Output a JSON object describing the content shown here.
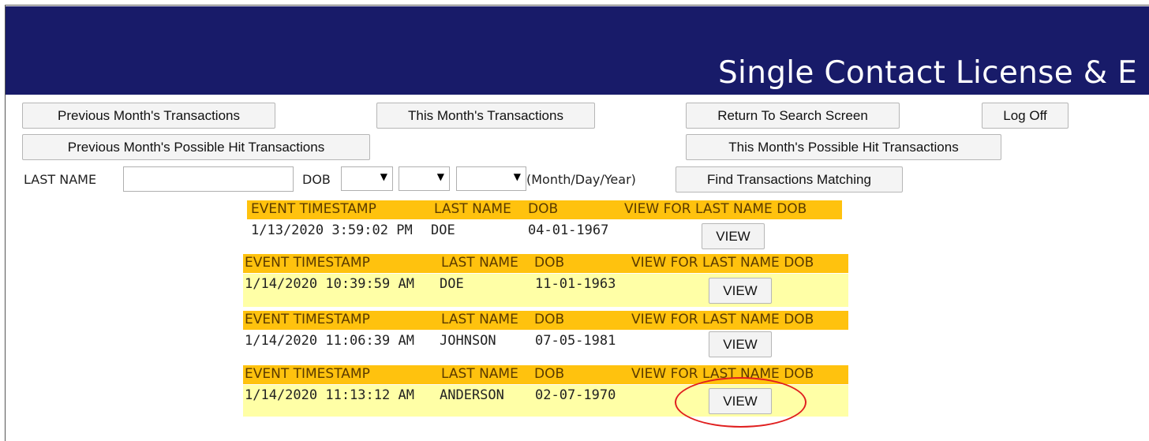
{
  "banner": {
    "title": "Single Contact License & E"
  },
  "nav": {
    "prev_month": "Previous Month's Transactions",
    "this_month": "This Month's Transactions",
    "return_search": "Return To Search Screen",
    "log_off": "Log  Off",
    "prev_month_hits": "Previous Month's Possible Hit Transactions",
    "this_month_hits": "This Month's Possible Hit Transactions"
  },
  "search": {
    "last_name_label": "LAST NAME",
    "last_name_value": "",
    "dob_label": "DOB",
    "month_value": "",
    "day_value": "",
    "year_value": "",
    "format_hint": "(Month/Day/Year)",
    "find_button": "Find Transactions Matching"
  },
  "results_headers": {
    "timestamp": "EVENT TIMESTAMP",
    "last_name": "LAST NAME",
    "dob": "DOB",
    "view": "VIEW FOR LAST NAME DOB"
  },
  "results": [
    {
      "timestamp": "1/13/2020 3:59:02 PM",
      "last_name": "DOE",
      "dob": "04-01-1967",
      "view_label": "VIEW"
    },
    {
      "timestamp": "1/14/2020 10:39:59 AM",
      "last_name": "DOE",
      "dob": "11-01-1963",
      "view_label": "VIEW"
    },
    {
      "timestamp": "1/14/2020 11:06:39 AM",
      "last_name": "JOHNSON",
      "dob": "07-05-1981",
      "view_label": "VIEW"
    },
    {
      "timestamp": "1/14/2020 11:13:12 AM",
      "last_name": "ANDERSON",
      "dob": "02-07-1970",
      "view_label": "VIEW"
    }
  ],
  "colors": {
    "banner": "#181b69",
    "header_row": "#ffc20e",
    "highlight_row": "#ffffa6",
    "annotation": "#e01f1f"
  }
}
